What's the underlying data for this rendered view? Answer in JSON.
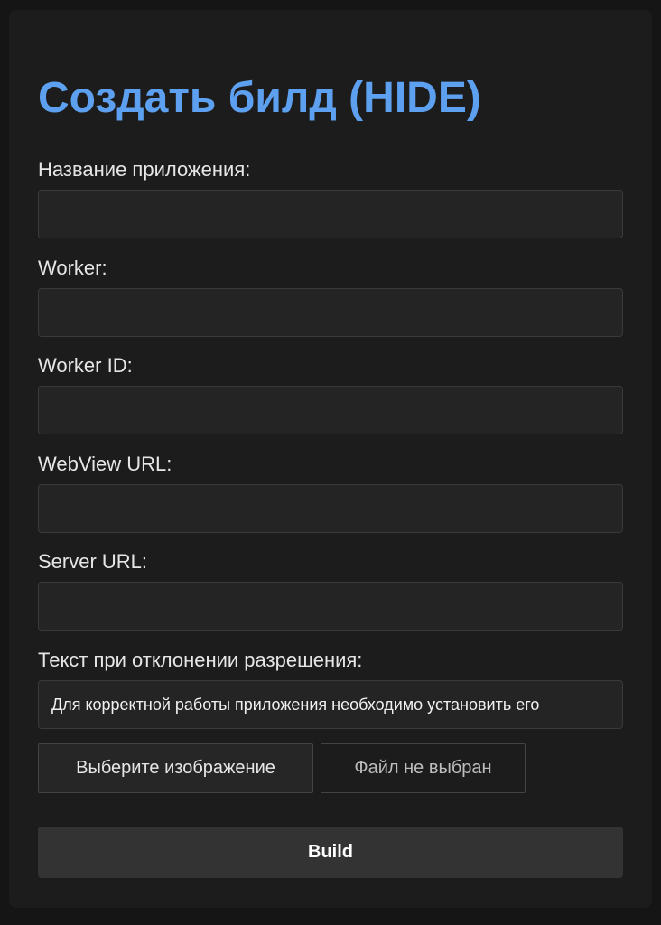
{
  "title": "Создать билд (HIDE)",
  "fields": [
    {
      "label": "Название приложения:",
      "value": "",
      "placeholder": ""
    },
    {
      "label": "Worker:",
      "value": "",
      "placeholder": ""
    },
    {
      "label": "Worker ID:",
      "value": "",
      "placeholder": ""
    },
    {
      "label": "WebView URL:",
      "value": "",
      "placeholder": ""
    },
    {
      "label": "Server URL:",
      "value": "",
      "placeholder": ""
    },
    {
      "label": "Текст при отклонении разрешения:",
      "value": "Для корректной работы приложения необходимо установить его",
      "placeholder": ""
    }
  ],
  "file_input": {
    "button_label": "Выберите изображение",
    "status": "Файл не выбран"
  },
  "build_button": "Build",
  "colors": {
    "page_background": "#151515",
    "card_background": "#1c1c1c",
    "title": "#5ea0f0",
    "field_background": "#242424",
    "build_button_background": "#333333"
  }
}
